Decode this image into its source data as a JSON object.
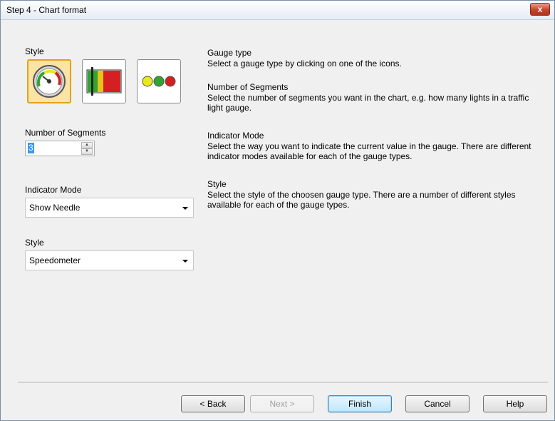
{
  "window": {
    "title": "Step 4 - Chart format",
    "close_label": "x"
  },
  "left": {
    "style_label": "Style",
    "style_icons": [
      {
        "name": "speedometer-gauge-icon",
        "selected": true
      },
      {
        "name": "bar-gauge-icon",
        "selected": false
      },
      {
        "name": "traffic-light-gauge-icon",
        "selected": false
      }
    ],
    "segments_label": "Number of Segments",
    "segments_value": "3",
    "indicator_label": "Indicator Mode",
    "indicator_value": "Show Needle",
    "style2_label": "Style",
    "style2_value": "Speedometer"
  },
  "help": {
    "gauge_type_title": "Gauge type",
    "gauge_type_text": "Select a gauge type by clicking on one of the icons.",
    "segments_title": "Number of Segments",
    "segments_text": "Select the number of segments you want in the chart, e.g. how many lights in a traffic light gauge.",
    "indicator_title": "Indicator Mode",
    "indicator_text": "Select the way you want to indicate the current value in the gauge. There are different indicator modes available for each of the gauge types.",
    "style_title": "Style",
    "style_text": "Select the style of the choosen gauge type. There are a number of different styles available for each of the gauge types."
  },
  "buttons": {
    "back": "< Back",
    "next": "Next >",
    "finish": "Finish",
    "cancel": "Cancel",
    "help": "Help"
  },
  "colors": {
    "selected_fill": "#fbe3a3",
    "selected_border": "#e3a21a",
    "needle_green": "#2fa52f",
    "needle_red": "#d42020",
    "light_yellow": "#e8e81a"
  }
}
